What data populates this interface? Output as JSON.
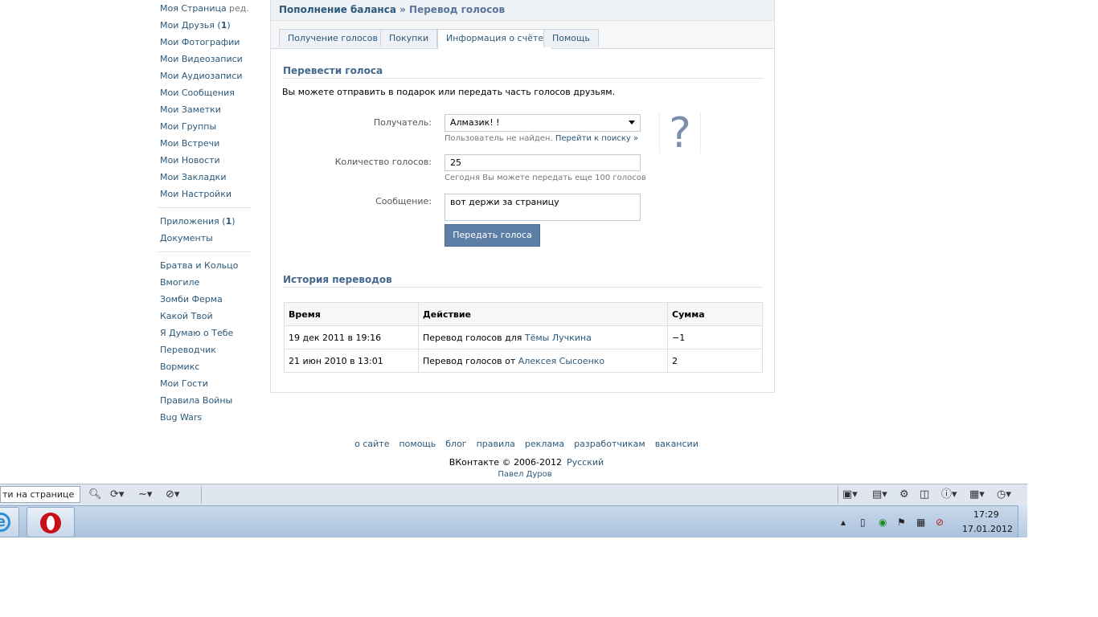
{
  "left_menu": {
    "edit_label": "ред.",
    "primary": [
      {
        "label": "Моя Страница"
      },
      {
        "label": "Мои Друзья",
        "count": "1"
      },
      {
        "label": "Мои Фотографии"
      },
      {
        "label": "Мои Видеозаписи"
      },
      {
        "label": "Мои Аудиозаписи"
      },
      {
        "label": "Мои Сообщения"
      },
      {
        "label": "Мои Заметки"
      },
      {
        "label": "Мои Группы"
      },
      {
        "label": "Мои Встречи"
      },
      {
        "label": "Мои Новости"
      },
      {
        "label": "Мои Закладки"
      },
      {
        "label": "Мои Настройки"
      }
    ],
    "secondary": [
      {
        "label": "Приложения",
        "count": "1"
      },
      {
        "label": "Документы"
      }
    ],
    "apps": [
      {
        "label": "Братва и Кольцо"
      },
      {
        "label": "Вмогиле"
      },
      {
        "label": "Зомби Ферма"
      },
      {
        "label": "Какой Твой"
      },
      {
        "label": "Я Думаю о Тебе"
      },
      {
        "label": "Переводчик"
      },
      {
        "label": "Вормикс"
      },
      {
        "label": "Мои Гости"
      },
      {
        "label": "Правила Войны"
      },
      {
        "label": "Bug Wars"
      }
    ]
  },
  "header": {
    "breadcrumb_root": "Пополнение баланса",
    "separator": " » ",
    "breadcrumb_current": "Перевод голосов"
  },
  "tabs": [
    {
      "label": "Получение голосов",
      "active": false
    },
    {
      "label": "Покупки",
      "active": false
    },
    {
      "label": "Информация о счёте",
      "active": true
    },
    {
      "label": "Помощь",
      "active": false
    }
  ],
  "transfer": {
    "title": "Перевести голоса",
    "description": "Вы можете отправить в подарок или передать часть голосов друзьям.",
    "recipient_label": "Получатель:",
    "recipient_value": "Алмазик! !",
    "recipient_hint": "Пользователь не найден.",
    "recipient_hint_link": "Перейти к поиску »",
    "avatar_glyph": "?",
    "amount_label": "Количество голосов:",
    "amount_value": "25",
    "amount_hint": "Сегодня Вы можете передать еще 100 голосов",
    "message_label": "Сообщение:",
    "message_value": "вот держи за страницу",
    "submit_label": "Передать голоса"
  },
  "history": {
    "title": "История переводов",
    "columns": [
      "Время",
      "Действие",
      "Сумма"
    ],
    "rows": [
      {
        "time": "19 дек 2011 в 19:16",
        "action": "Перевод голосов для",
        "user": "Тёмы Лучкина",
        "sum": "−1"
      },
      {
        "time": "21 июн 2010 в 13:01",
        "action": "Перевод голосов от",
        "user": "Алексея Сысоенко",
        "sum": "2"
      }
    ]
  },
  "footer": {
    "links": [
      "о сайте",
      "помощь",
      "блог",
      "правила",
      "реклама",
      "разработчикам",
      "вакансии"
    ],
    "copyright": "ВКонтакте © 2006-2012",
    "language": "Русский",
    "author": "Павел Дуров"
  },
  "findbar": {
    "find_value": "ти на странице"
  },
  "taskbar": {
    "time": "17:29",
    "date": "17.01.2012"
  },
  "icons": {
    "ie": "ie-icon",
    "opera": "opera-icon"
  }
}
